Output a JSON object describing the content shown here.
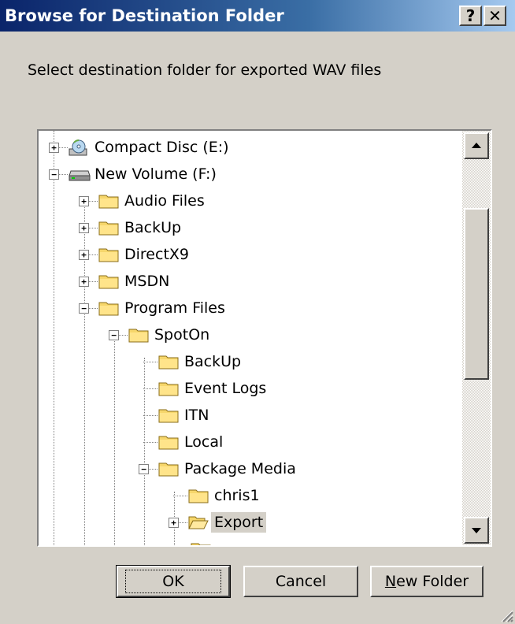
{
  "window": {
    "title": "Browse for Destination Folder"
  },
  "titlebar_buttons": {
    "help": "?",
    "close": "✕"
  },
  "prompt": "Select destination folder for exported WAV files",
  "tree": {
    "items": [
      {
        "label": "Compact Disc (E:)",
        "icon": "cd-drive-icon",
        "expander": "+"
      },
      {
        "label": "New Volume (F:)",
        "icon": "hard-drive-icon",
        "expander": "−"
      },
      {
        "label": "Audio Files",
        "icon": "folder-icon",
        "expander": "+"
      },
      {
        "label": "BackUp",
        "icon": "folder-icon",
        "expander": "+"
      },
      {
        "label": "DirectX9",
        "icon": "folder-icon",
        "expander": "+"
      },
      {
        "label": "MSDN",
        "icon": "folder-icon",
        "expander": "+"
      },
      {
        "label": "Program Files",
        "icon": "folder-icon",
        "expander": "−"
      },
      {
        "label": "SpotOn",
        "icon": "folder-icon",
        "expander": "−"
      },
      {
        "label": "BackUp",
        "icon": "folder-icon",
        "expander": ""
      },
      {
        "label": "Event Logs",
        "icon": "folder-icon",
        "expander": ""
      },
      {
        "label": "ITN",
        "icon": "folder-icon",
        "expander": ""
      },
      {
        "label": "Local",
        "icon": "folder-icon",
        "expander": ""
      },
      {
        "label": "Package Media",
        "icon": "folder-icon",
        "expander": "−"
      },
      {
        "label": "chris1",
        "icon": "folder-icon",
        "expander": ""
      },
      {
        "label": "Export",
        "icon": "open-folder-icon",
        "expander": "+"
      }
    ]
  },
  "scrollbar": {
    "up": "▲",
    "down": "▼"
  },
  "buttons": {
    "ok": "OK",
    "cancel": "Cancel",
    "new_folder_underlined": "N",
    "new_folder_rest": "ew Folder"
  },
  "colors": {
    "titlebar_start": "#0a246a",
    "dialog_bg": "#d4d0c8",
    "folder": "#f6d66b"
  }
}
